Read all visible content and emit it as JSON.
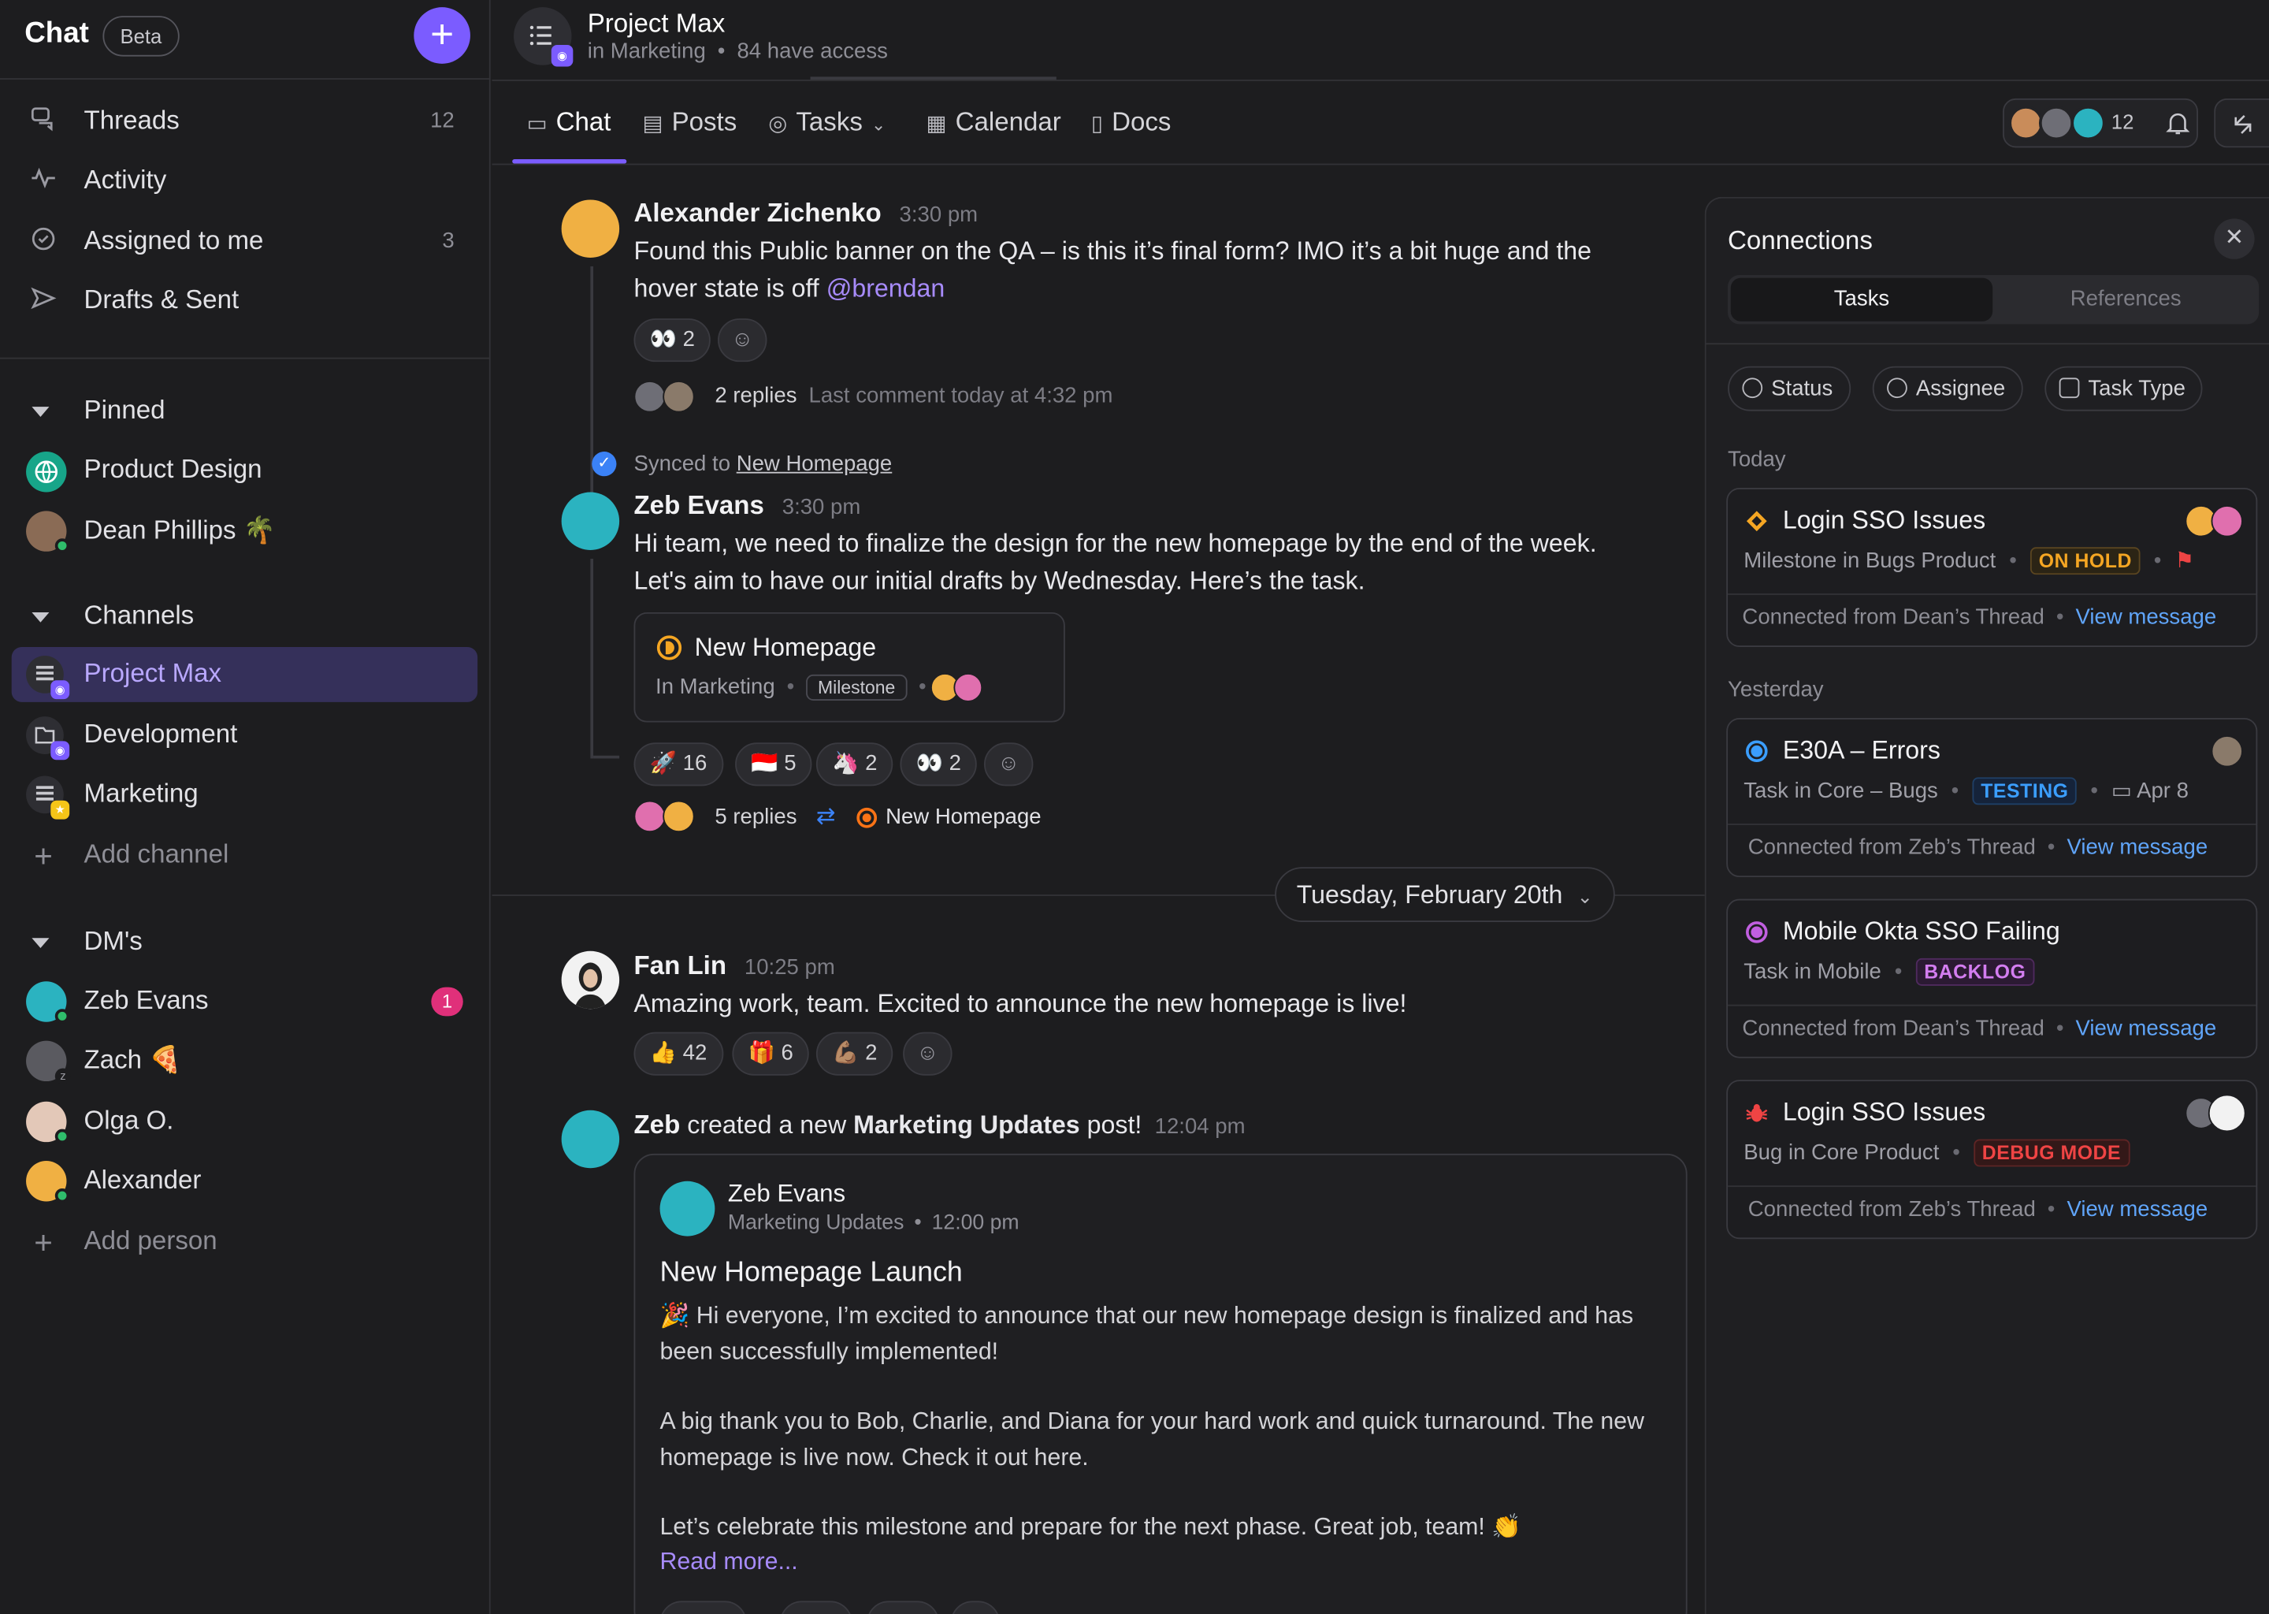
{
  "sidebar": {
    "title": "Chat",
    "beta_label": "Beta",
    "nav": [
      {
        "label": "Threads",
        "count": "12",
        "icon": "threads-icon"
      },
      {
        "label": "Activity",
        "count": "",
        "icon": "activity-icon"
      },
      {
        "label": "Assigned to me",
        "count": "3",
        "icon": "assigned-icon"
      },
      {
        "label": "Drafts & Sent",
        "count": "",
        "icon": "send-icon"
      }
    ],
    "pinned_label": "Pinned",
    "pinned": [
      {
        "label": "Product Design"
      },
      {
        "label": "Dean Phillips 🌴"
      }
    ],
    "channels_label": "Channels",
    "channels": [
      {
        "label": "Project Max"
      },
      {
        "label": "Development"
      },
      {
        "label": "Marketing"
      }
    ],
    "add_channel_label": "Add channel",
    "dms_label": "DM's",
    "dms": [
      {
        "label": "Zeb Evans",
        "badge": "1"
      },
      {
        "label": "Zach 🍕",
        "badge": ""
      },
      {
        "label": "Olga O.",
        "badge": ""
      },
      {
        "label": "Alexander",
        "badge": ""
      }
    ],
    "add_person_label": "Add person"
  },
  "header": {
    "title": "Project Max",
    "location": "in Marketing",
    "access": "84 have access",
    "member_count": "12",
    "tabs": [
      {
        "label": "Chat"
      },
      {
        "label": "Posts"
      },
      {
        "label": "Tasks"
      },
      {
        "label": "Calendar"
      },
      {
        "label": "Docs"
      }
    ]
  },
  "messages": {
    "m1": {
      "author": "Alexander Zichenko",
      "time": "3:30 pm",
      "text_before": "Found this Public banner on the QA – is this it’s final form? IMO it’s a bit huge and the hover state is off ",
      "mention": "@brendan",
      "reaction": "👀 2",
      "replies": "2 replies",
      "last_comment": "Last comment today at 4:32 pm"
    },
    "synced_prefix": "Synced to",
    "synced_link": "New Homepage",
    "m2": {
      "author": "Zeb Evans",
      "time": "3:30 pm",
      "text": "Hi team, we need to finalize the design for the new homepage by the end of the week. Let's aim to have our initial drafts by Wednesday. Here’s the task.",
      "task_title": "New Homepage",
      "task_location": "In Marketing",
      "task_chip": "Milestone",
      "reactions": [
        "🚀 16",
        "🇮🇩 5",
        "🦄 2",
        "👀 2"
      ],
      "replies": "5 replies",
      "linked_task": "New Homepage"
    },
    "date_divider": "Tuesday, February 20th",
    "m3": {
      "author": "Fan Lin",
      "time": "10:25 pm",
      "text": "Amazing work, team. Excited to announce the new homepage is live!",
      "reactions": [
        "👍 42",
        "🎁 6",
        "💪🏽 2"
      ]
    },
    "m4": {
      "author": "Zeb",
      "action": "created a new",
      "post_name": "Marketing Updates",
      "action_suffix": "post!",
      "time": "12:04 pm",
      "post_author": "Zeb Evans",
      "post_channel": "Marketing Updates",
      "post_time": "12:00 pm",
      "post_title": "New Homepage Launch",
      "para1": "🎉 Hi everyone, I’m excited to announce that our new homepage design is finalized and has been successfully implemented!",
      "para2": "A big thank you to Bob, Charlie, and Diana for your hard work and quick turnaround. The new homepage is live now. Check it out here.",
      "para3": "Let’s celebrate this milestone and prepare for the next phase. Great job, team! 👏",
      "read_more": "Read more..."
    }
  },
  "connections": {
    "title": "Connections",
    "seg_tasks": "Tasks",
    "seg_references": "References",
    "filters": [
      "Status",
      "Assignee",
      "Task Type"
    ],
    "today_label": "Today",
    "yesterday_label": "Yesterday",
    "cards": [
      {
        "title": "Login SSO Issues",
        "sub": "Milestone in Bugs Product",
        "status": "ON HOLD",
        "status_color": "#f5a623",
        "from": "Connected from Dean’s Thread",
        "link": "View message",
        "icon": "diamond-icon"
      },
      {
        "title": "E30A – Errors",
        "sub": "Task in Core – Bugs",
        "status": "TESTING",
        "status_color": "#3b9eff",
        "date": "Apr 8",
        "from": "Connected from Zeb’s Thread",
        "link": "View message",
        "icon": "status-circle-icon"
      },
      {
        "title": "Mobile Okta SSO Failing",
        "sub": "Task in Mobile",
        "status": "BACKLOG",
        "status_color": "#c15fe0",
        "from": "Connected from Dean’s Thread",
        "link": "View message",
        "icon": "status-circle-icon"
      },
      {
        "title": "Login SSO Issues",
        "sub": "Bug in Core Product",
        "status": "DEBUG MODE",
        "status_color": "#ef4444",
        "from": "Connected from Zeb’s Thread",
        "link": "View message",
        "icon": "bug-icon"
      }
    ]
  },
  "colors": {
    "accent": "#7b5cff",
    "link": "#60a5fa",
    "background": "#1d1d1f"
  }
}
